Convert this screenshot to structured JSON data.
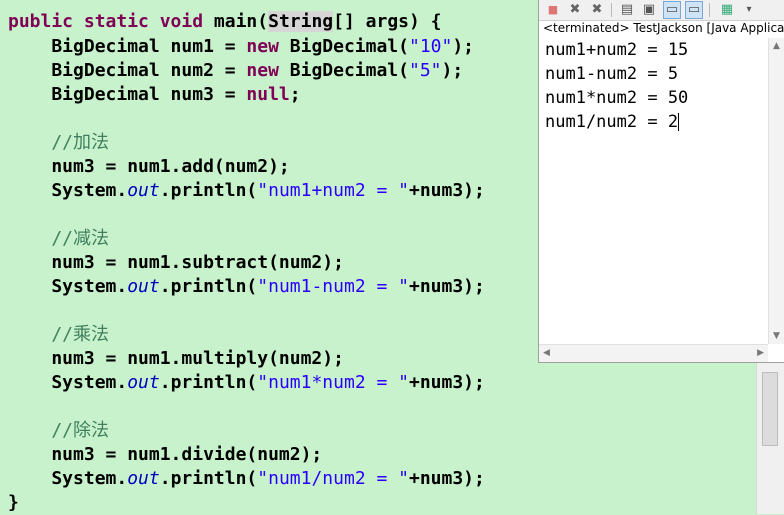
{
  "code": {
    "l1": {
      "kw1": "public static void",
      "t1": " main(",
      "hl": "String",
      "t2": "[] args) {"
    },
    "l2": {
      "t1": "    BigDecimal num1 = ",
      "kw": "new",
      "t2": " BigDecimal(",
      "s": "\"10\"",
      "t3": ");"
    },
    "l3": {
      "t1": "    BigDecimal num2 = ",
      "kw": "new",
      "t2": " BigDecimal(",
      "s": "\"5\"",
      "t3": ");"
    },
    "l4": {
      "t1": "    BigDecimal num3 = ",
      "kw": "null",
      "t2": ";"
    },
    "c_add": "    //加法",
    "add1": "    num3 = num1.add(num2);",
    "p_add": {
      "t1": "    System.",
      "f": "out",
      "t2": ".println(",
      "s": "\"num1+num2 = \"",
      "t3": "+num3);"
    },
    "c_sub": "    //减法",
    "sub1": "    num3 = num1.subtract(num2);",
    "p_sub": {
      "t1": "    System.",
      "f": "out",
      "t2": ".println(",
      "s": "\"num1-num2 = \"",
      "t3": "+num3);"
    },
    "c_mul": "    //乘法",
    "mul1": "    num3 = num1.multiply(num2);",
    "p_mul": {
      "t1": "    System.",
      "f": "out",
      "t2": ".println(",
      "s": "\"num1*num2 = \"",
      "t3": "+num3);"
    },
    "c_div": "    //除法",
    "div1": "    num3 = num1.divide(num2);",
    "p_div": {
      "t1": "    System.",
      "f": "out",
      "t2": ".println(",
      "s": "\"num1/num2 = \"",
      "t3": "+num3);"
    },
    "close": "}"
  },
  "console": {
    "status": "<terminated> TestJackson [Java Applicat",
    "lines": [
      "num1+num2 = 15",
      "num1-num2 = 5",
      "num1*num2 = 50",
      "num1/num2 = 2"
    ]
  },
  "toolbar_icons": [
    "terminate-icon",
    "remove-launch-icon",
    "remove-all-icon",
    "clear-console-icon",
    "scroll-lock-icon",
    "show-when-output-icon",
    "show-when-error-icon",
    "pin-console-icon",
    "display-selected-console-icon"
  ],
  "colors": {
    "editor_bg": "#c8f2cb",
    "keyword": "#7f0055",
    "string": "#2a00ff",
    "comment": "#3f7f5f",
    "field": "#0000c0"
  }
}
